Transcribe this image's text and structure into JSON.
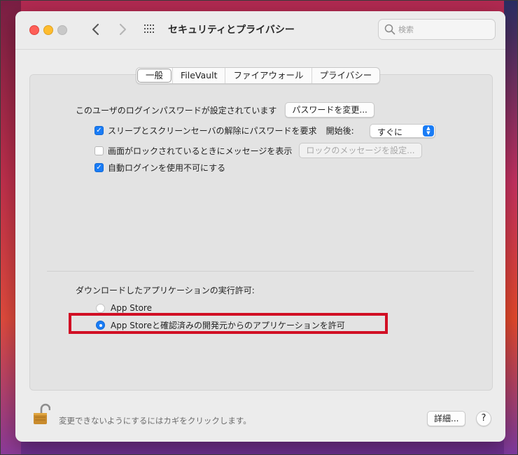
{
  "window": {
    "title": "セキュリティとプライバシー"
  },
  "search": {
    "placeholder": "検索"
  },
  "tabs": [
    {
      "label": "一般",
      "active": true
    },
    {
      "label": "FileVault",
      "active": false
    },
    {
      "label": "ファイアウォール",
      "active": false
    },
    {
      "label": "プライバシー",
      "active": false
    }
  ],
  "login": {
    "password_text": "このユーザのログインパスワードが設定されています",
    "change_password_button": "パスワードを変更...",
    "require_password": {
      "label": "スリープとスクリーンセーバの解除にパスワードを要求",
      "checked": true
    },
    "after_label": "開始後:",
    "after_value": "すぐに",
    "show_message": {
      "label": "画面がロックされているときにメッセージを表示",
      "checked": false
    },
    "set_message_button": "ロックのメッセージを設定...",
    "disable_autologin": {
      "label": "自動ログインを使用不可にする",
      "checked": true
    }
  },
  "downloads": {
    "heading": "ダウンロードしたアプリケーションの実行許可:",
    "options": [
      {
        "label": "App Store",
        "selected": false
      },
      {
        "label": "App Storeと確認済みの開発元からのアプリケーションを許可",
        "selected": true
      }
    ]
  },
  "footer": {
    "lock_text": "変更できないようにするにはカギをクリックします。",
    "details_button": "詳細...",
    "help_button": "?"
  },
  "colors": {
    "accent": "#1a7cf5",
    "highlight_border": "#d10f24"
  }
}
